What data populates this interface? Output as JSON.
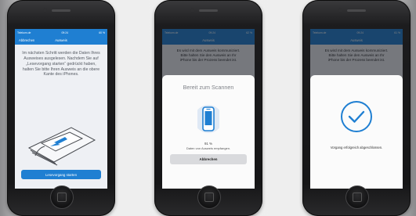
{
  "screens": [
    {
      "status": {
        "carrier": "Telekom.de",
        "time": "09:24",
        "battery": "60 %"
      },
      "nav": {
        "back_label": "Abbrechen",
        "title": "Ausweis"
      },
      "instruction": "Im nächsten Schritt werden die Daten Ihres Ausweises ausgelesen. Nachdem Sie auf „Lesevorgang starten“ gedrückt haben, halten Sie bitte Ihren Ausweis an die obere Kante des iPhones.",
      "primary_button": "Lesevorgang starten"
    },
    {
      "status": {
        "carrier": "Telekom.de",
        "time": "09:24",
        "battery": "62 %"
      },
      "nav": {
        "title": "Ausweis"
      },
      "background_text": "Es wird mit dem Ausweis kommuniziert. Bitte halten Sie den Ausweis an Ihr iPhone bis der Prozess beendet ist.",
      "sheet": {
        "title": "Bereit zum Scannen",
        "progress": "91 %",
        "status_text": "Daten von Ausweis empfangen.",
        "cancel_button": "Abbrechen"
      }
    },
    {
      "status": {
        "carrier": "Telekom.de",
        "time": "09:24",
        "battery": "61 %"
      },
      "nav": {
        "title": "Ausweis"
      },
      "background_text": "Es wird mit dem Ausweis kommuniziert. Bitte halten Sie den Ausweis an Ihr iPhone bis der Prozess beendet ist.",
      "success_text": "Vorgang erfolgreich abgeschlossen."
    }
  ],
  "colors": {
    "accent": "#1f7fd2",
    "success": "#1f7fd2"
  },
  "icons": [
    "phone-icon",
    "checkmark-icon",
    "id-card-illustration"
  ]
}
